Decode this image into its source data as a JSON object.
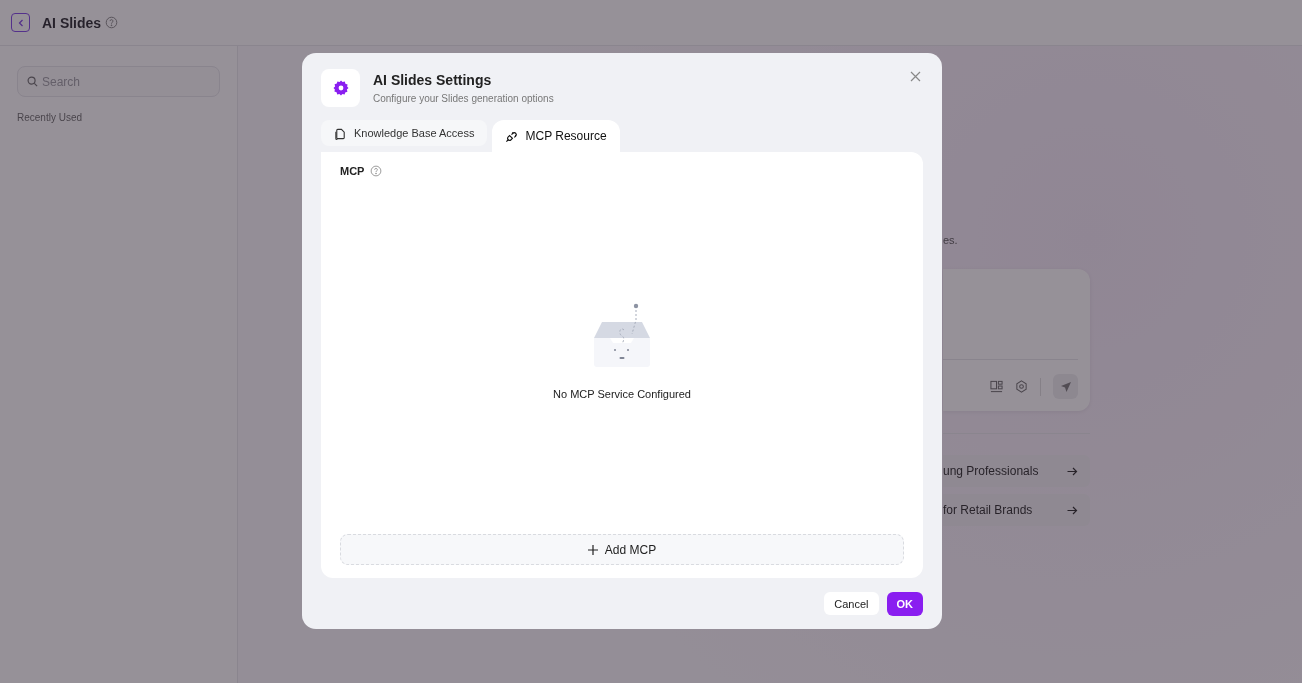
{
  "app": {
    "title": "AI Slides",
    "search": {
      "placeholder": "Search"
    },
    "section_label": "Recently Used",
    "main": {
      "intro_text": "es.",
      "suggestions": [
        "ung Professionals",
        "for Retail Brands"
      ]
    }
  },
  "dialog": {
    "title": "AI Slides Settings",
    "subtitle": "Configure your Slides generation options",
    "tabs": [
      {
        "label": "Knowledge Base Access",
        "kind": "document",
        "selected": false
      },
      {
        "label": "MCP Resource",
        "kind": "plug",
        "selected": true
      }
    ],
    "section_label": "MCP",
    "empty_message": "No MCP Service Configured",
    "add_button": "Add MCP",
    "buttons": {
      "cancel": "Cancel",
      "ok": "OK"
    }
  }
}
